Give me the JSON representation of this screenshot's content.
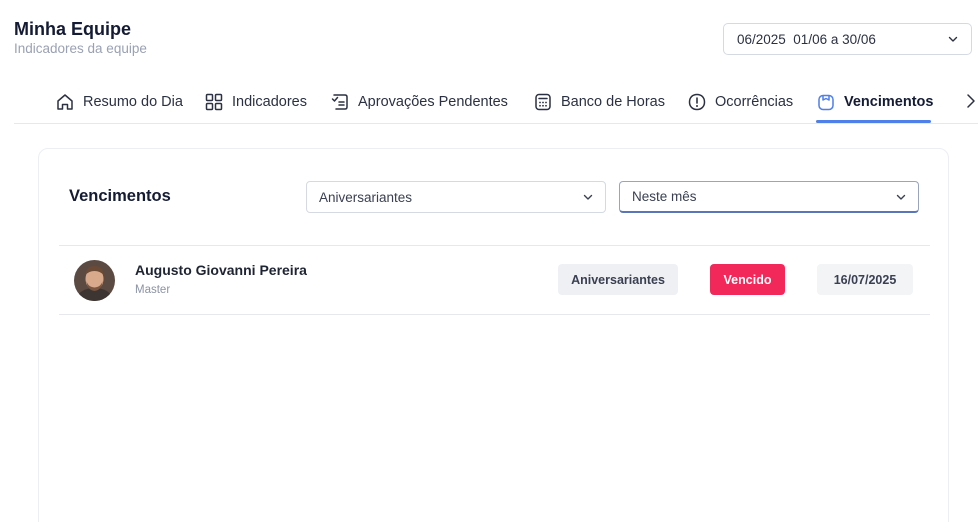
{
  "header": {
    "title": "Minha Equipe",
    "subtitle": "Indicadores da equipe",
    "period_value": "06/2025  01/06 a 30/06"
  },
  "tabs": [
    {
      "label": "Resumo do Dia",
      "icon": "home-icon"
    },
    {
      "label": "Indicadores",
      "icon": "grid-icon"
    },
    {
      "label": "Aprovações Pendentes",
      "icon": "approval-list-icon"
    },
    {
      "label": "Banco de Horas",
      "icon": "calculator-icon"
    },
    {
      "label": "Ocorrências",
      "icon": "alert-circle-icon"
    },
    {
      "label": "Vencimentos",
      "icon": "calendar-icon",
      "active": true
    }
  ],
  "card": {
    "title": "Vencimentos",
    "type_filter_value": "Aniversariantes",
    "period_filter_value": "Neste mês"
  },
  "items": [
    {
      "name": "Augusto Giovanni Pereira",
      "role": "Master",
      "category": "Aniversariantes",
      "status": "Vencido",
      "date": "16/07/2025"
    }
  ],
  "colors": {
    "accent": "#4f7fe8",
    "status_overdue": "#f2275a",
    "title_text": "#141b34",
    "muted_text": "#9aa1b3"
  }
}
